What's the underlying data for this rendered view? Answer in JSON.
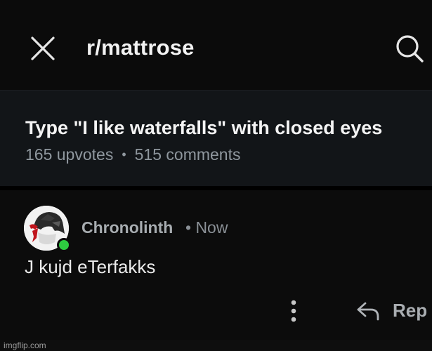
{
  "header": {
    "title": "r/mattrose",
    "close_icon": "close-icon",
    "search_icon": "search-icon"
  },
  "post": {
    "title": "Type \"I like waterfalls\" with closed eyes",
    "upvotes": "165 upvotes",
    "separator": "•",
    "comments": "515 comments"
  },
  "comment": {
    "username": "Chronolinth",
    "timestamp": "• Now",
    "body": "J kujd eTerfakks",
    "online_status_color": "#2ecc40",
    "more_icon": "more-vertical-icon",
    "reply_icon": "reply-icon",
    "reply_label": "Rep"
  },
  "watermark": {
    "text": "imgflip.com"
  }
}
